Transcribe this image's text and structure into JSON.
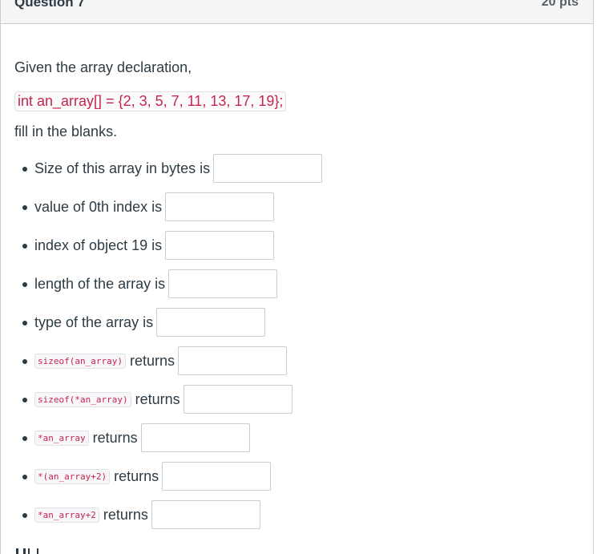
{
  "header": {
    "title": "Question 7",
    "points": "20 pts"
  },
  "question": {
    "intro": "Given the array declaration,",
    "declaration": "int an_array[] = {2, 3, 5, 7, 11, 13, 17, 19};",
    "instruction": "fill in the blanks."
  },
  "items": [
    {
      "code": "",
      "label": "Size of this array in bytes is",
      "value": ""
    },
    {
      "code": "",
      "label": "value of 0th index is",
      "value": ""
    },
    {
      "code": "",
      "label": "index of object 19 is",
      "value": ""
    },
    {
      "code": "",
      "label": "length of the array is",
      "value": ""
    },
    {
      "code": "",
      "label": "type of the array is",
      "value": ""
    },
    {
      "code": "sizeof(an_array)",
      "label": "returns",
      "value": ""
    },
    {
      "code": "sizeof(*an_array)",
      "label": "returns",
      "value": ""
    },
    {
      "code": "*an_array",
      "label": "returns",
      "value": ""
    },
    {
      "code": "*(an_array+2)",
      "label": "returns",
      "value": ""
    },
    {
      "code": "*an_array+2",
      "label": "returns",
      "value": ""
    }
  ]
}
